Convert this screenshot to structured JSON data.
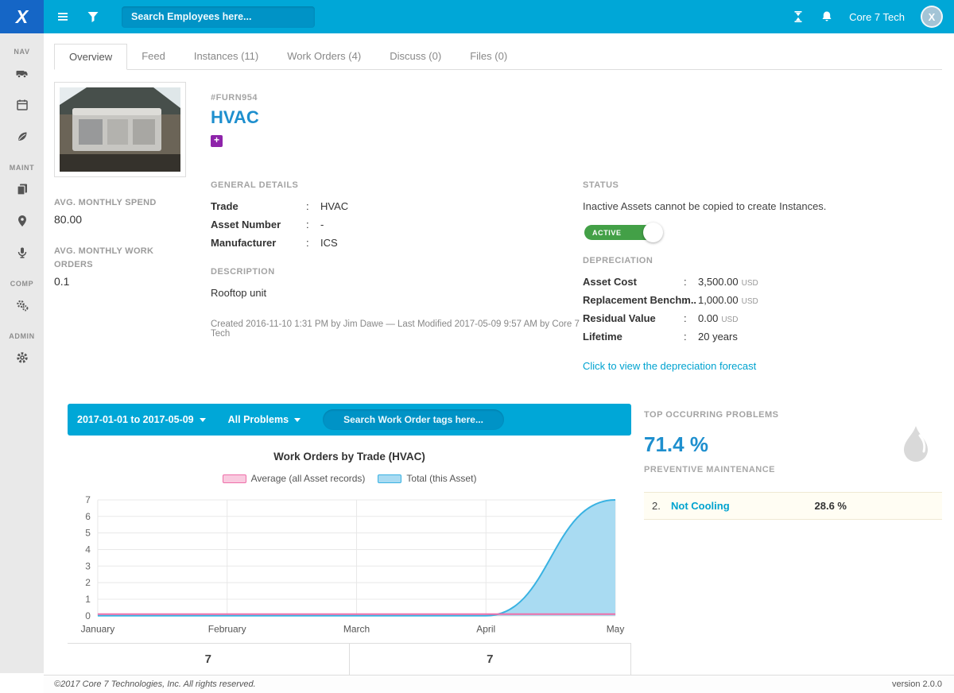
{
  "ui": {
    "colon": ":"
  },
  "topbar": {
    "brand": "X",
    "search_placeholder": "Search Employees here...",
    "account_name": "Core 7 Tech",
    "avatar_initial": "X"
  },
  "sidebar": {
    "sections": [
      {
        "label": "NAV"
      },
      {
        "label": "MAINT"
      },
      {
        "label": "COMP"
      },
      {
        "label": "ADMIN"
      }
    ]
  },
  "tabs": [
    {
      "label": "Overview"
    },
    {
      "label": "Feed"
    },
    {
      "label": "Instances (11)"
    },
    {
      "label": "Work Orders (4)"
    },
    {
      "label": "Discuss (0)"
    },
    {
      "label": "Files (0)"
    }
  ],
  "asset": {
    "id": "#FURN954",
    "name": "HVAC",
    "add_label": "+",
    "stats": [
      {
        "label": "AVG. MONTHLY SPEND",
        "value": "80.00"
      },
      {
        "label": "AVG. MONTHLY WORK ORDERS",
        "value": "0.1"
      }
    ],
    "general_details": {
      "heading": "GENERAL DETAILS",
      "rows": [
        {
          "label": "Trade",
          "value": "HVAC"
        },
        {
          "label": "Asset Number",
          "value": "-"
        },
        {
          "label": "Manufacturer",
          "value": "ICS"
        }
      ]
    },
    "description": {
      "heading": "DESCRIPTION",
      "text": "Rooftop unit"
    },
    "meta": "Created 2016-11-10 1:31 PM by Jim Dawe — Last Modified 2017-05-09 9:57 AM by Core 7 Tech",
    "status": {
      "heading": "STATUS",
      "note": "Inactive Assets cannot be copied to create Instances.",
      "toggle_label": "ACTIVE"
    },
    "depreciation": {
      "heading": "DEPRECIATION",
      "rows": [
        {
          "label": "Asset Cost",
          "value": "3,500.00",
          "unit": "USD"
        },
        {
          "label": "Replacement Benchm..",
          "value": "1,000.00",
          "unit": "USD"
        },
        {
          "label": "Residual Value",
          "value": "0.00",
          "unit": "USD"
        },
        {
          "label": "Lifetime",
          "value": "20 years",
          "unit": ""
        }
      ],
      "link": "Click to view the depreciation forecast"
    }
  },
  "chart_toolbar": {
    "date_range": "2017-01-01 to 2017-05-09",
    "problems_filter": "All Problems",
    "search_placeholder": "Search Work Order tags here..."
  },
  "chart_data": {
    "type": "area",
    "title": "Work Orders by Trade (HVAC)",
    "x_labels": [
      "January",
      "February",
      "March",
      "April",
      "May"
    ],
    "ylim": [
      0,
      7
    ],
    "yticks": [
      0,
      1,
      2,
      3,
      4,
      5,
      6,
      7
    ],
    "grid": true,
    "legend_position": "top",
    "series": [
      {
        "name": "Average (all Asset records)",
        "values": [
          0.1,
          0.1,
          0.1,
          0.1,
          0.1
        ],
        "color": "#ee6fa9",
        "fill": "#f9cadf",
        "area": false
      },
      {
        "name": "Total (this Asset)",
        "values": [
          0,
          0,
          0,
          0,
          7
        ],
        "color": "#39b2e2",
        "fill": "#a9dbf2",
        "area": true
      }
    ],
    "footer_counts": [
      "7",
      "7"
    ]
  },
  "problems_panel": {
    "heading": "TOP OCCURRING PROBLEMS",
    "top_percent": "71.4 %",
    "top_label": "PREVENTIVE MAINTENANCE",
    "items": [
      {
        "rank": "2.",
        "label": "Not Cooling",
        "percent": "28.6 %"
      }
    ]
  },
  "footer": {
    "copyright": "©2017 Core 7 Technologies, Inc. All rights reserved.",
    "version": "version 2.0.0"
  },
  "colors": {
    "accent": "#00a7d7",
    "logo_bg": "#1566c6",
    "heading_blue": "#1e8fce",
    "toggle_green": "#43a047",
    "badge_purple": "#8e24aa"
  }
}
